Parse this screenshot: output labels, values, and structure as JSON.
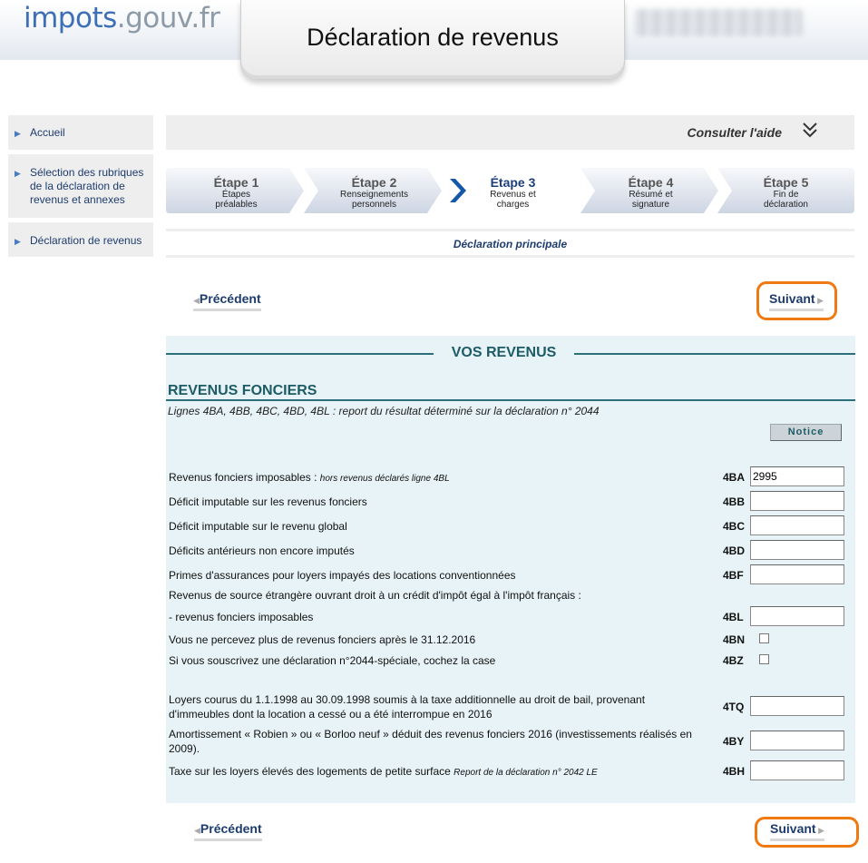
{
  "header": {
    "logo_part1": "impots",
    "logo_part2": ".gouv.fr",
    "title": "Déclaration de revenus"
  },
  "sidebar": {
    "items": [
      {
        "label": "Accueil"
      },
      {
        "label": "Sélection des rubriques de la déclaration de revenus et annexes"
      },
      {
        "label": "Déclaration de revenus"
      }
    ]
  },
  "help": {
    "label": "Consulter l'aide",
    "icon": "double-chevron-down-icon"
  },
  "steps": [
    {
      "name": "Étape 1",
      "sub": "Étapes préalables",
      "active": false
    },
    {
      "name": "Étape 2",
      "sub": "Renseignements personnels",
      "active": false
    },
    {
      "name": "Étape 3",
      "sub": "Revenus et charges",
      "active": true
    },
    {
      "name": "Étape 4",
      "sub": "Résumé et signature",
      "active": false
    },
    {
      "name": "Étape 5",
      "sub": "Fin de déclaration",
      "active": false
    }
  ],
  "decl_label": "Déclaration principale",
  "nav": {
    "prev_label": "Précédent",
    "next_label": "Suivant"
  },
  "section": {
    "title": "VOS REVENUS",
    "subtitle": "REVENUS FONCIERS",
    "description": "Lignes 4BA, 4BB, 4BC, 4BD, 4BL : report du résultat déterminé sur la déclaration n° 2044",
    "notice_label": "Notice"
  },
  "rows": [
    {
      "label": "Revenus fonciers imposables :",
      "note": "hors revenus déclarés ligne 4BL",
      "code": "4BA",
      "type": "input",
      "value": "2995"
    },
    {
      "label": "Déficit imputable sur les revenus fonciers",
      "code": "4BB",
      "type": "input",
      "value": ""
    },
    {
      "label": "Déficit imputable sur le revenu global",
      "code": "4BC",
      "type": "input",
      "value": ""
    },
    {
      "label": "Déficits antérieurs non encore imputés",
      "code": "4BD",
      "type": "input",
      "value": ""
    },
    {
      "label": "Primes d'assurances pour loyers impayés des locations conventionnées",
      "code": "4BF",
      "type": "input",
      "value": ""
    },
    {
      "label": "Revenus de source étrangère ouvrant droit à un crédit d'impôt égal à l'impôt français :",
      "type": "heading"
    },
    {
      "label": "- revenus fonciers imposables",
      "code": "4BL",
      "type": "input",
      "value": ""
    },
    {
      "label": "Vous ne percevez plus de revenus fonciers après le 31.12.2016",
      "code": "4BN",
      "type": "checkbox",
      "checked": false
    },
    {
      "label": "Si vous souscrivez une déclaration n°2044-spéciale, cochez la case",
      "code": "4BZ",
      "type": "checkbox",
      "checked": false
    },
    {
      "label": "Loyers courus du 1.1.1998 au 30.09.1998 soumis à la taxe additionnelle au droit de bail, provenant d'immeubles dont la location a cessé ou a été interrompue en 2016",
      "code": "4TQ",
      "type": "input",
      "value": ""
    },
    {
      "label": "Amortissement « Robien » ou « Borloo neuf » déduit des revenus fonciers 2016 (investissements réalisés en 2009).",
      "code": "4BY",
      "type": "input",
      "value": ""
    },
    {
      "label": "Taxe sur les loyers élevés des logements de petite surface",
      "note": "Report de la déclaration n° 2042 LE",
      "code": "4BH",
      "type": "input",
      "value": ""
    }
  ],
  "colors": {
    "accent_dark_blue": "#1d3c6e",
    "section_teal": "#1d5b66",
    "section_bg": "#e7f3f6",
    "highlight_orange": "#f07a12"
  }
}
